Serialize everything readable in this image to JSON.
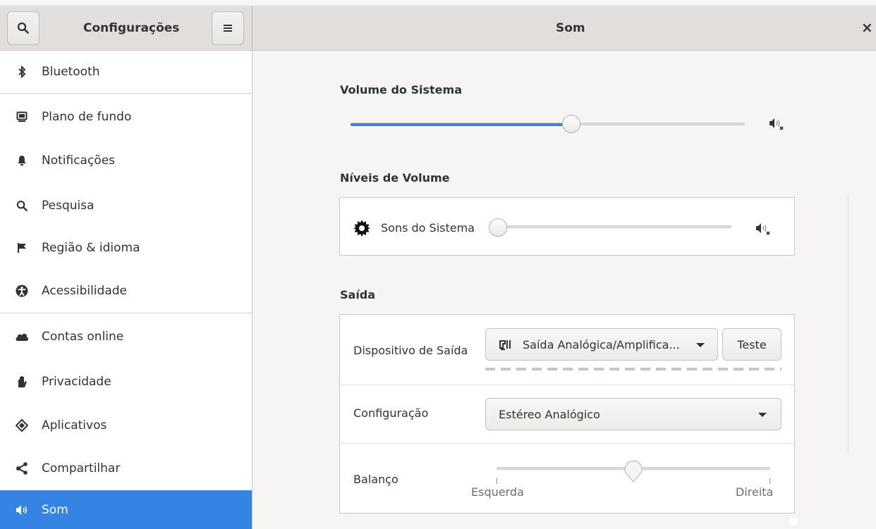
{
  "header": {
    "title": "Configurações",
    "panel_title": "Som",
    "close_label": "×"
  },
  "sidebar": {
    "items": [
      {
        "label": "Bluetooth",
        "icon": "bluetooth-icon"
      },
      {
        "label": "Plano de fundo",
        "icon": "background-icon"
      },
      {
        "label": "Notificações",
        "icon": "bell-icon"
      },
      {
        "label": "Pesquisa",
        "icon": "search-icon"
      },
      {
        "label": "Região & idioma",
        "icon": "flag-icon"
      },
      {
        "label": "Acessibilidade",
        "icon": "accessibility-icon"
      },
      {
        "label": "Contas online",
        "icon": "cloud-icon"
      },
      {
        "label": "Privacidade",
        "icon": "hand-icon"
      },
      {
        "label": "Aplicativos",
        "icon": "apps-icon"
      },
      {
        "label": "Compartilhar",
        "icon": "share-icon"
      },
      {
        "label": "Som",
        "icon": "speaker-icon",
        "active": true
      }
    ]
  },
  "sound": {
    "system_volume": {
      "title": "Volume do Sistema",
      "level": 0.56
    },
    "volume_levels": {
      "title": "Níveis de Volume",
      "system_sounds_label": "Sons do Sistema",
      "level": 0.0
    },
    "output": {
      "title": "Saída",
      "device_label": "Dispositivo de Saída",
      "device_value": "Saída Analógica/Amplifica...",
      "test_label": "Teste",
      "config_label": "Configuração",
      "config_value": "Estéreo Analógico",
      "balance_label": "Balanço",
      "balance_left": "Esquerda",
      "balance_right": "Direita",
      "balance_value": 0.5
    }
  },
  "colors": {
    "accent": "#3584e4",
    "header": "#e1dedb",
    "background": "#f6f5f4"
  }
}
